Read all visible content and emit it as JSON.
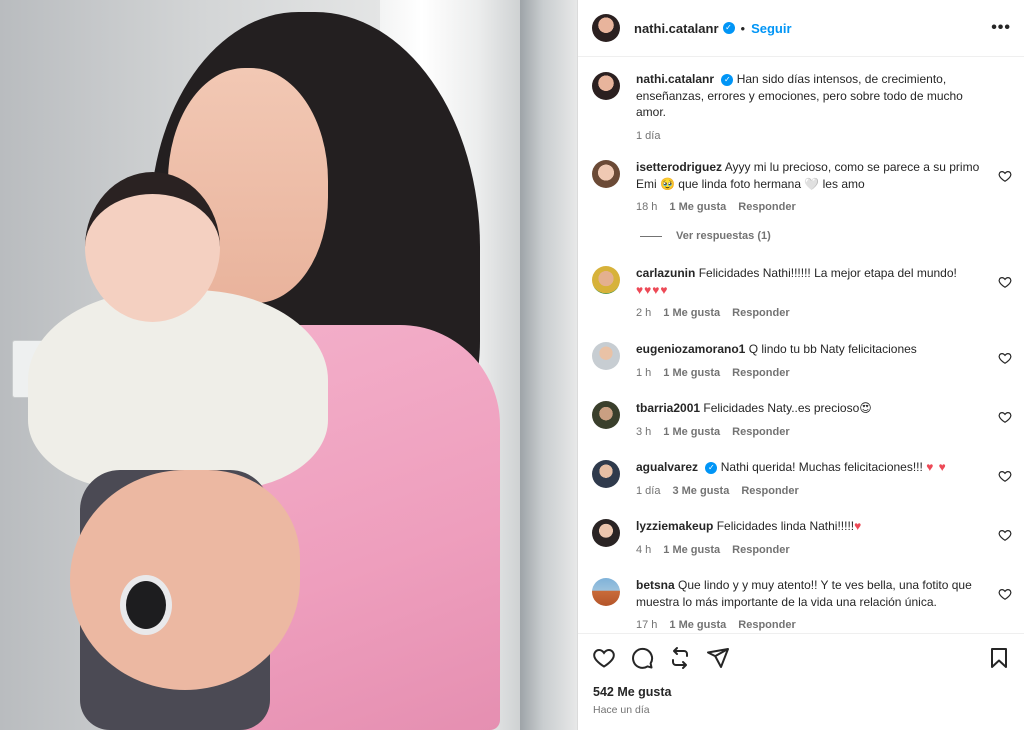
{
  "post": {
    "username": "nathi.catalanr",
    "follow_label": "Seguir",
    "separator": "•",
    "more_label": "•••",
    "caption": "Han sido días intensos, de crecimiento, enseñanzas, errores y emociones, pero sobre todo de mucho amor.",
    "caption_time": "1 día",
    "likes": "542 Me gusta",
    "posted": "Hace un día"
  },
  "view_replies": "Ver respuestas (1)",
  "reply_label": "Responder",
  "comments": [
    {
      "username": "isetterodriguez",
      "text": "Ayyy mi lu precioso, como se parece a su primo Emi 🥹  que linda foto hermana 🤍  les amo",
      "time": "18 h",
      "likes": "1 Me gusta"
    },
    {
      "username": "carlazunin",
      "text": "Felicidades Nathi!!!!!! La mejor etapa del mundo!",
      "hearts": "♥♥♥♥",
      "time": "2 h",
      "likes": "1 Me gusta"
    },
    {
      "username": "eugeniozamorano1",
      "text": "Q lindo tu bb Naty felicitaciones",
      "time": "1 h",
      "likes": "1 Me gusta"
    },
    {
      "username": "tbarria2001",
      "text": "Felicidades Naty..es precioso😍",
      "time": "3 h",
      "likes": "1 Me gusta"
    },
    {
      "username": "agualvarez",
      "text": "Nathi querida! Muchas felicitaciones!!!",
      "hearts": "♥ ♥",
      "time": "1 día",
      "likes": "3 Me gusta"
    },
    {
      "username": "lyzziemakeup",
      "text": "Felicidades linda Nathi!!!!!",
      "hearts": "♥",
      "time": "4 h",
      "likes": "1 Me gusta"
    },
    {
      "username": "betsna",
      "text": "Que lindo y y muy atento!! Y te ves bella, una fotito que muestra lo más importante de la vida una relación única.",
      "time": "17 h",
      "likes": "1 Me gusta"
    }
  ],
  "icons": {
    "like": "heart-icon",
    "comment": "comment-icon",
    "share": "repost-icon",
    "send": "send-icon",
    "save": "bookmark-icon",
    "verified": "verified-badge-icon"
  },
  "colors": {
    "link": "#0095f6",
    "heart": "#ed4956",
    "muted": "#737373"
  }
}
